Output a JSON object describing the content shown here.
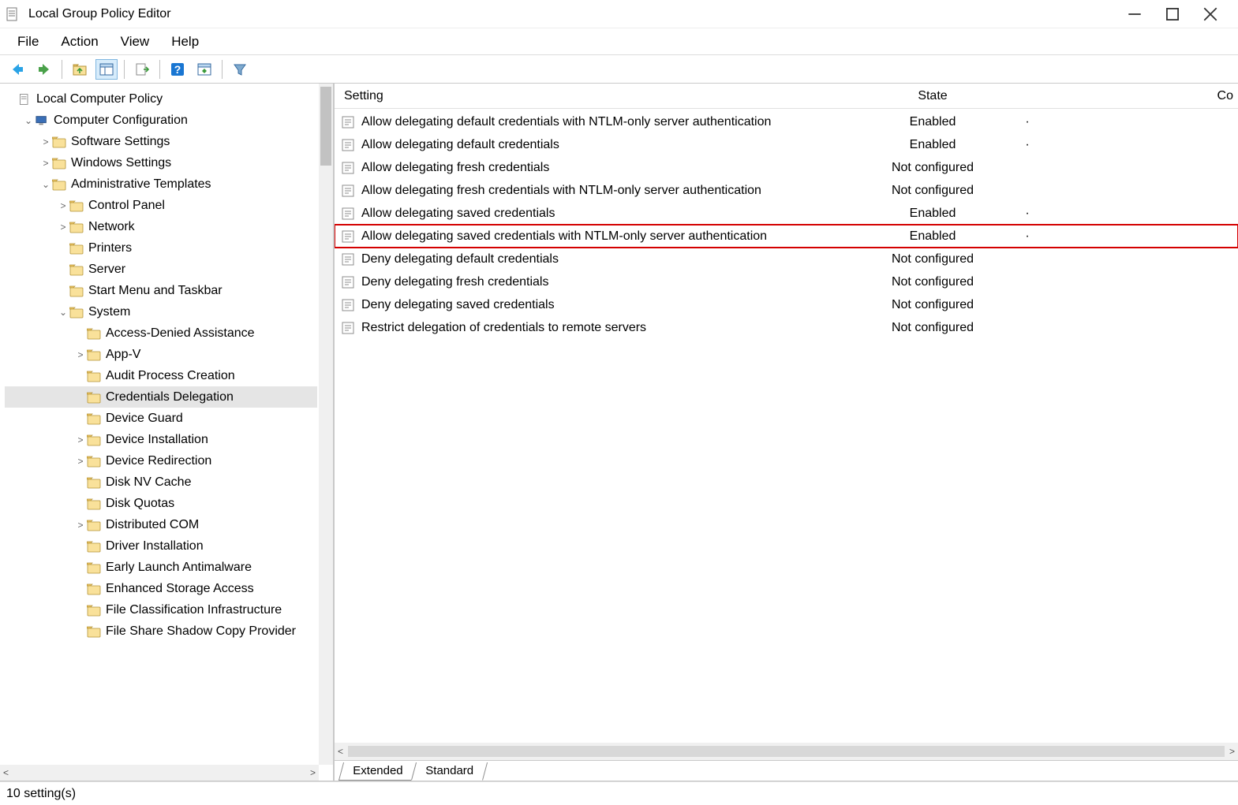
{
  "app_title": "Local Group Policy Editor",
  "menus": {
    "file": "File",
    "action": "Action",
    "view": "View",
    "help": "Help"
  },
  "tree": {
    "root": "Local Computer Policy",
    "computer_config": "Computer Configuration",
    "software_settings": "Software Settings",
    "windows_settings": "Windows Settings",
    "admin_templates": "Administrative Templates",
    "control_panel": "Control Panel",
    "network": "Network",
    "printers": "Printers",
    "server": "Server",
    "start_menu": "Start Menu and Taskbar",
    "system": "System",
    "access_denied": "Access-Denied Assistance",
    "appv": "App-V",
    "audit": "Audit Process Creation",
    "cred_deleg": "Credentials Delegation",
    "device_guard": "Device Guard",
    "device_install": "Device Installation",
    "device_redir": "Device Redirection",
    "disk_nv": "Disk NV Cache",
    "disk_quotas": "Disk Quotas",
    "dcom": "Distributed COM",
    "driver_install": "Driver Installation",
    "early_launch": "Early Launch Antimalware",
    "enhanced_storage": "Enhanced Storage Access",
    "file_class": "File Classification Infrastructure",
    "file_share": "File Share Shadow Copy Provider"
  },
  "columns": {
    "setting": "Setting",
    "state": "State",
    "comment": "Co"
  },
  "rows": [
    {
      "setting": "Allow delegating default credentials with NTLM-only server authentication",
      "state": "Enabled",
      "dot": "·",
      "highlight": false
    },
    {
      "setting": "Allow delegating default credentials",
      "state": "Enabled",
      "dot": "·",
      "highlight": false
    },
    {
      "setting": "Allow delegating fresh credentials",
      "state": "Not configured",
      "dot": "",
      "highlight": false
    },
    {
      "setting": "Allow delegating fresh credentials with NTLM-only server authentication",
      "state": "Not configured",
      "dot": "",
      "highlight": false
    },
    {
      "setting": "Allow delegating saved credentials",
      "state": "Enabled",
      "dot": "·",
      "highlight": false
    },
    {
      "setting": "Allow delegating saved credentials with NTLM-only server authentication",
      "state": "Enabled",
      "dot": "·",
      "highlight": true
    },
    {
      "setting": "Deny delegating default credentials",
      "state": "Not configured",
      "dot": "",
      "highlight": false
    },
    {
      "setting": "Deny delegating fresh credentials",
      "state": "Not configured",
      "dot": "",
      "highlight": false
    },
    {
      "setting": "Deny delegating saved credentials",
      "state": "Not configured",
      "dot": "",
      "highlight": false
    },
    {
      "setting": "Restrict delegation of credentials to remote servers",
      "state": "Not configured",
      "dot": "",
      "highlight": false
    }
  ],
  "tabs": {
    "extended": "Extended",
    "standard": "Standard"
  },
  "status": "10 setting(s)"
}
